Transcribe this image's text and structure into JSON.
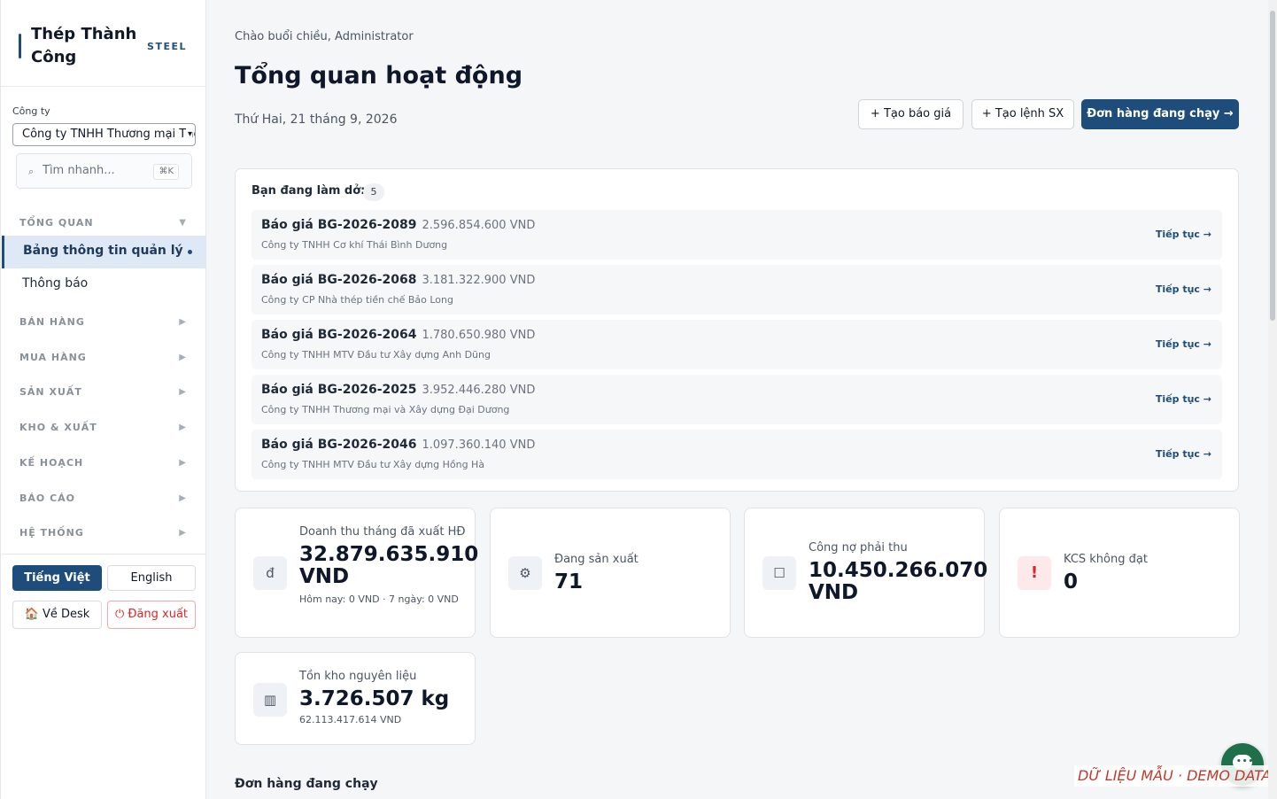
{
  "brand": {
    "name": "Thép Thành Công",
    "tag": "STEEL"
  },
  "company": {
    "label": "Công ty",
    "value": "Công ty TNHH Thương mại Thép"
  },
  "search": {
    "placeholder": "Tìm nhanh...",
    "shortcut": "⌘K"
  },
  "nav": {
    "overview_group": "TỔNG QUAN",
    "active_item": "Bảng thông tin quản lý",
    "item_notifications": "Thông báo",
    "groups": [
      "BÁN HÀNG",
      "MUA HÀNG",
      "SẢN XUẤT",
      "KHO & XUẤT",
      "KẾ HOẠCH",
      "BÁO CÁO",
      "HỆ THỐNG"
    ]
  },
  "footer": {
    "lang_vi": "Tiếng Việt",
    "lang_en": "English",
    "desk": "🏠 Về Desk",
    "logout": "⏻ Đăng xuất"
  },
  "header": {
    "greeting": "Chào buổi chiều, Administrator",
    "title": "Tổng quan hoạt động",
    "date": "Thứ Hai, 21 tháng 9, 2026",
    "btn_quote": "+ Tạo báo giá",
    "btn_production": "+ Tạo lệnh SX",
    "btn_orders": "Đơn hàng đang chạy →"
  },
  "wip": {
    "title": "Bạn đang làm dở:",
    "count": "5",
    "continue_label": "Tiếp tục →",
    "rows": [
      {
        "code": "Báo giá BG-2026-2089",
        "amount": "2.596.854.600 VND",
        "customer": "Công ty TNHH Cơ khí Thái Bình Dương"
      },
      {
        "code": "Báo giá BG-2026-2068",
        "amount": "3.181.322.900 VND",
        "customer": "Công ty CP Nhà thép tiền chế Bảo Long"
      },
      {
        "code": "Báo giá BG-2026-2064",
        "amount": "1.780.650.980 VND",
        "customer": "Công ty TNHH MTV Đầu tư Xây dựng Anh Dũng"
      },
      {
        "code": "Báo giá BG-2026-2025",
        "amount": "3.952.446.280 VND",
        "customer": "Công ty TNHH Thương mại và Xây dựng Đại Dương"
      },
      {
        "code": "Báo giá BG-2026-2046",
        "amount": "1.097.360.140 VND",
        "customer": "Công ty TNHH MTV Đầu tư Xây dựng Hồng Hà"
      }
    ]
  },
  "kpis": {
    "revenue": {
      "icon": "đ",
      "label": "Doanh thu tháng đã xuất HĐ",
      "value": "32.879.635.910 VND",
      "note": "Hôm nay: 0 VND · 7 ngày: 0 VND"
    },
    "production": {
      "icon": "⚙",
      "label": "Đang sản xuất",
      "value": "71"
    },
    "receivable": {
      "icon": "☐",
      "label": "Công nợ phải thu",
      "value": "10.450.266.070 VND"
    },
    "qc_failed": {
      "icon": "!",
      "label": "KCS không đạt",
      "value": "0"
    },
    "inventory": {
      "icon": "▥",
      "label": "Tồn kho nguyên liệu",
      "value": "3.726.507 kg",
      "note": "62.113.417.614 VND"
    }
  },
  "section_running_orders": "Đơn hàng đang chạy",
  "watermark": "DỮ LIỆU MẪU · DEMO DATA"
}
